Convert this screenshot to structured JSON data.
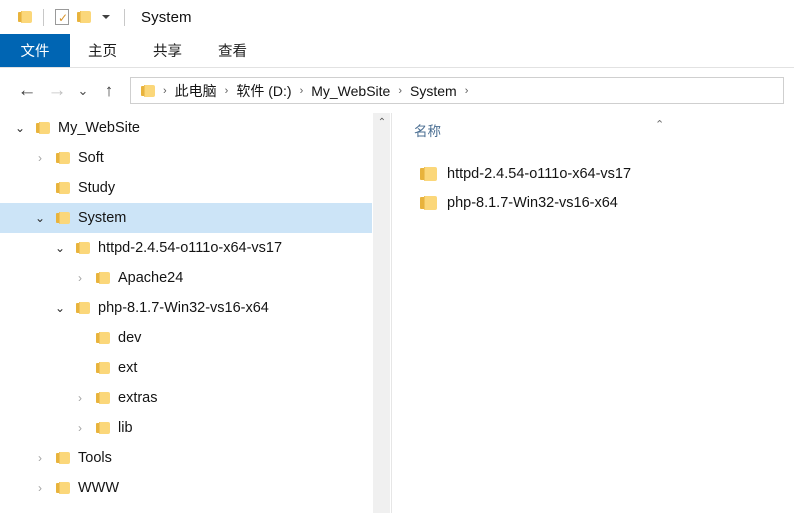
{
  "window": {
    "title": "System"
  },
  "quick_access": {
    "items": [
      {
        "name": "folder-icon",
        "label": ""
      },
      {
        "name": "properties-icon",
        "label": ""
      },
      {
        "name": "new-folder-icon",
        "label": ""
      },
      {
        "name": "customize-dropdown-icon",
        "label": ""
      }
    ]
  },
  "ribbon": {
    "tabs": [
      {
        "label": "文件",
        "active": true
      },
      {
        "label": "主页",
        "active": false
      },
      {
        "label": "共享",
        "active": false
      },
      {
        "label": "查看",
        "active": false
      }
    ]
  },
  "navigation": {
    "back_icon": "←",
    "forward_icon": "→",
    "recent_icon": "⌄",
    "up_icon": "↑",
    "breadcrumbs": [
      "此电脑",
      "软件 (D:)",
      "My_WebSite",
      "System"
    ],
    "separator": "›"
  },
  "tree": {
    "items": [
      {
        "label": "My_WebSite",
        "indent": 1,
        "state": "open",
        "selected": false
      },
      {
        "label": "Soft",
        "indent": 2,
        "state": "closed",
        "selected": false
      },
      {
        "label": "Study",
        "indent": 2,
        "state": "none",
        "selected": false
      },
      {
        "label": "System",
        "indent": 2,
        "state": "open",
        "selected": true
      },
      {
        "label": "httpd-2.4.54-o111o-x64-vs17",
        "indent": 3,
        "state": "open",
        "selected": false
      },
      {
        "label": "Apache24",
        "indent": 4,
        "state": "closed",
        "selected": false
      },
      {
        "label": "php-8.1.7-Win32-vs16-x64",
        "indent": 3,
        "state": "open",
        "selected": false
      },
      {
        "label": "dev",
        "indent": 4,
        "state": "none",
        "selected": false
      },
      {
        "label": "ext",
        "indent": 4,
        "state": "none",
        "selected": false
      },
      {
        "label": "extras",
        "indent": 4,
        "state": "closed",
        "selected": false
      },
      {
        "label": "lib",
        "indent": 4,
        "state": "closed",
        "selected": false
      },
      {
        "label": "Tools",
        "indent": 2,
        "state": "closed",
        "selected": false
      },
      {
        "label": "WWW",
        "indent": 2,
        "state": "closed",
        "selected": false
      }
    ],
    "glyph_open": "⌄",
    "glyph_closed": "›",
    "scrollbar_up_glyph": "⌃"
  },
  "file_list": {
    "column_header": "名称",
    "sort_caret": "⌃",
    "rows": [
      {
        "name": "httpd-2.4.54-o111o-x64-vs17"
      },
      {
        "name": "php-8.1.7-Win32-vs16-x64"
      }
    ]
  },
  "colors": {
    "accent_blue": "#0065b3",
    "selection_blue": "#cce4f7",
    "folder_yellow": "#fbd77a",
    "header_blue_gray": "#4a6e92"
  }
}
